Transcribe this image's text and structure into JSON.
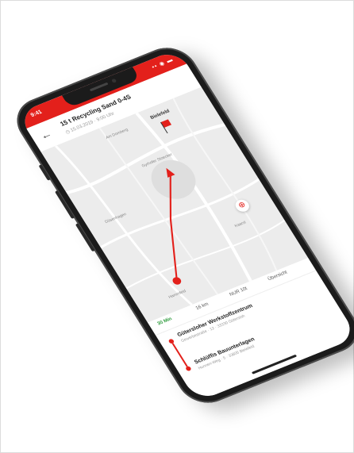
{
  "status": {
    "time": "9:41",
    "icons": "▪▪ ◉ ▬"
  },
  "header": {
    "back_icon": "←",
    "title": "15 t Recycling Sand 0-4S",
    "subtitle": "◷ 15.03.2019 · 9:00 Uhr"
  },
  "map": {
    "labels": {
      "district_top": "Am Domberg",
      "district_mid": "Gyrhofer Stoecker",
      "district_left": "Düsenhagen",
      "city": "Bielefeld",
      "district_bottom": "Hammfeld",
      "district_bottom2": "Kaarst"
    },
    "target_icon": "⊕",
    "colors": {
      "route": "#e3201b",
      "accent": "#e3201b"
    }
  },
  "route_tabs": [
    {
      "label": "30 Min",
      "active": true
    },
    {
      "label": "16 km",
      "active": false
    },
    {
      "label": "NUR 10t",
      "active": false
    },
    {
      "label": "Übersicht",
      "active": false
    }
  ],
  "stops": [
    {
      "name": "Gütersloher Werkstoffzentrum",
      "address": "Gewerbestraße · 12 · 33330 Gütersloh"
    },
    {
      "name": "Schlüffis Bauunterlagen",
      "address": "Hunnen-Weg · 5 · 33605 Bielefeld"
    }
  ]
}
